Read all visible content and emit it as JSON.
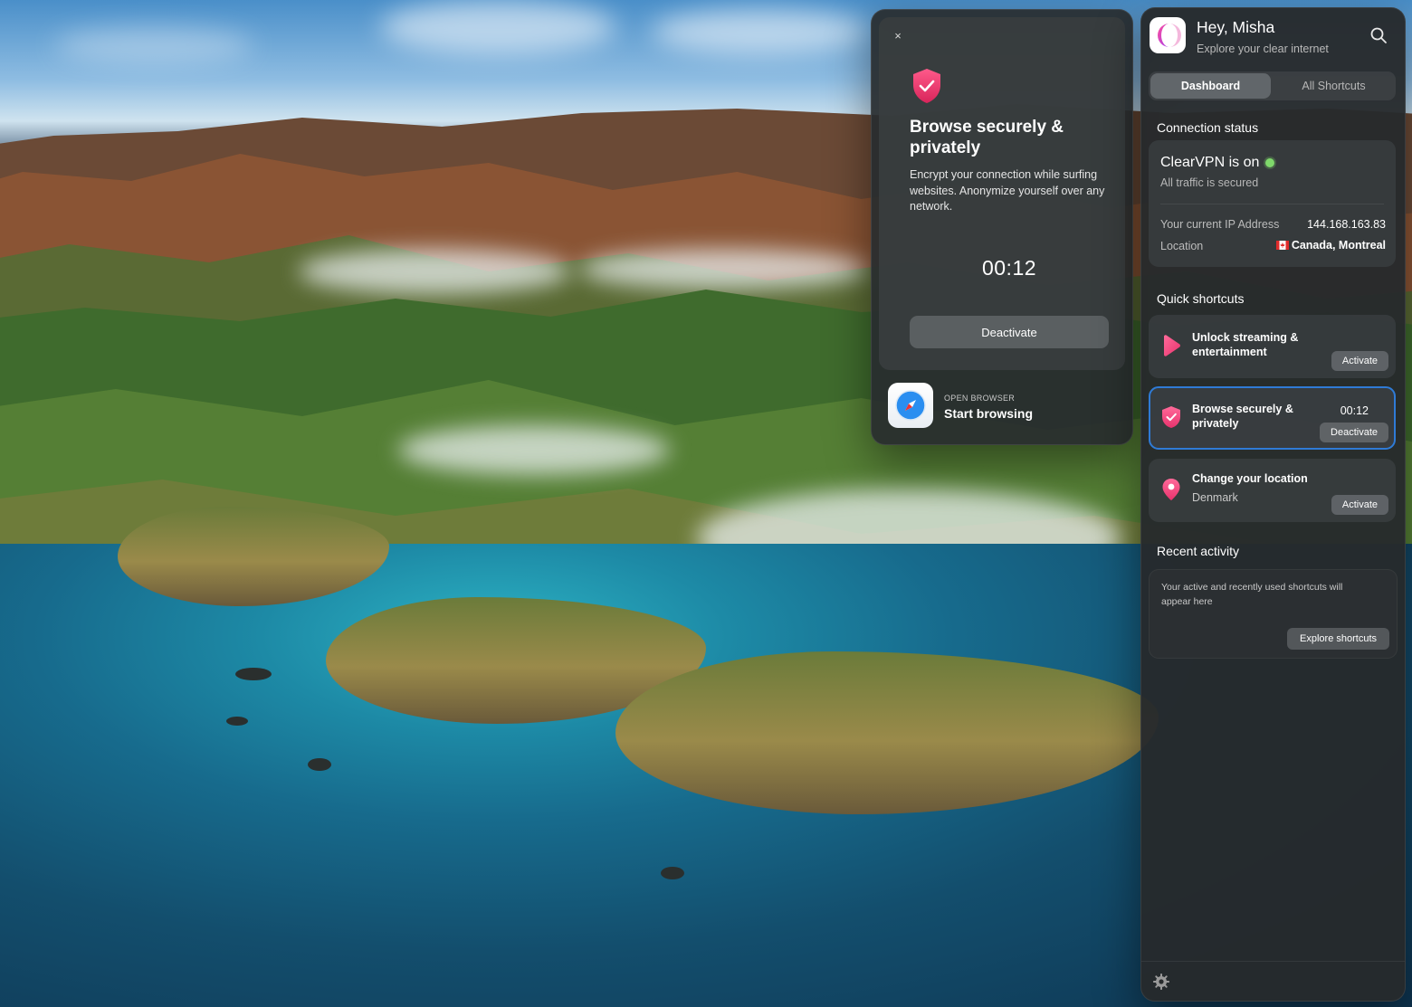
{
  "detail_panel": {
    "close_icon": "×",
    "title": "Browse securely & privately",
    "description": "Encrypt your connection while surfing websites. Anonymize yourself over any network.",
    "timer": "00:12",
    "deactivate_label": "Deactivate",
    "browser": {
      "caption": "OPEN BROWSER",
      "title": "Start browsing",
      "icon": "safari-compass-icon"
    }
  },
  "sidebar": {
    "greeting": "Hey, Misha",
    "tagline": "Explore your clear internet",
    "tabs": [
      {
        "label": "Dashboard",
        "active": true
      },
      {
        "label": "All Shortcuts",
        "active": false
      }
    ],
    "connection": {
      "section_title": "Connection status",
      "status": "ClearVPN is on",
      "sub": "All traffic is secured",
      "ip_label": "Your current IP Address",
      "ip_value": "144.168.163.83",
      "location_label": "Location",
      "location_value": "Canada, Montreal"
    },
    "quick_shortcuts": {
      "section_title": "Quick shortcuts",
      "items": [
        {
          "name": "Unlock streaming & entertainment",
          "sub": "",
          "button": "Activate",
          "icon": "play-icon"
        },
        {
          "name": "Browse securely & privately",
          "sub": "",
          "time": "00:12",
          "button": "Deactivate",
          "icon": "shield-check-icon"
        },
        {
          "name": "Change your location",
          "sub": "Denmark",
          "button": "Activate",
          "icon": "location-pin-icon"
        }
      ]
    },
    "recent_activity": {
      "section_title": "Recent activity",
      "message": "Your active and recently used shortcuts will appear here",
      "button": "Explore shortcuts"
    }
  },
  "colors": {
    "accent_pink": "#e8336d",
    "active_border": "#2f7bd6",
    "status_green": "#7fd86b"
  }
}
